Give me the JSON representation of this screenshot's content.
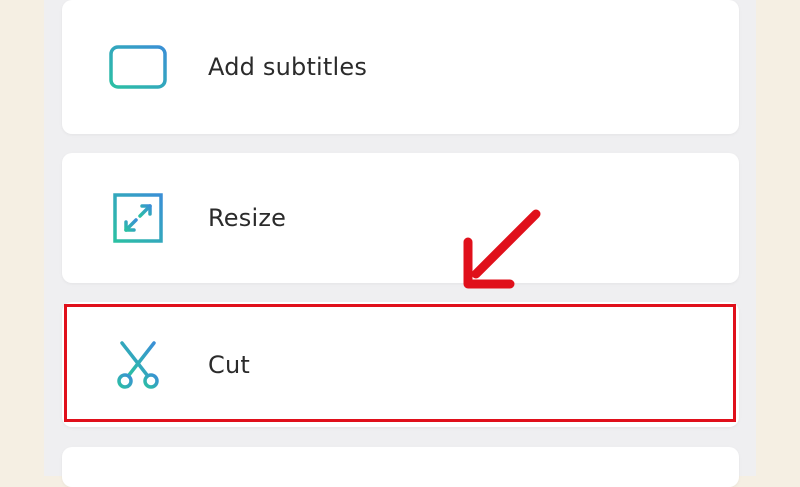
{
  "menu": {
    "items": [
      {
        "label": "Add subtitles",
        "icon": "subtitles-icon"
      },
      {
        "label": "Resize",
        "icon": "resize-icon"
      },
      {
        "label": "Cut",
        "icon": "scissors-icon"
      }
    ]
  },
  "colors": {
    "icon_teal": "#2bb9a8",
    "icon_blue": "#3a8fd6",
    "highlight_red": "#e0101b",
    "background": "#f5efe3",
    "card": "#ffffff"
  },
  "annotation": {
    "arrow_icon": "red-arrow-icon",
    "highlighted_item": "Cut"
  }
}
